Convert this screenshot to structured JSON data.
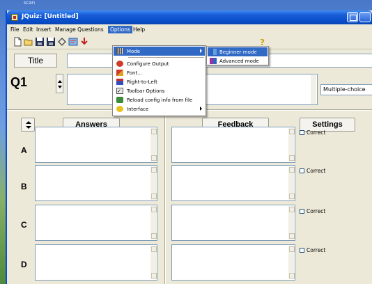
{
  "desktop": {
    "label": "scan"
  },
  "window": {
    "title": "JQuiz: [Untitled]"
  },
  "menubar": {
    "items": [
      "File",
      "Edit",
      "Insert",
      "Manage Questions",
      "Options",
      "Help"
    ],
    "active": "Options"
  },
  "toolbar": {
    "icons": [
      "new-icon",
      "open-icon",
      "save-icon",
      "save-as-icon",
      "clear-icon",
      "web-page-icon",
      "export-icon",
      "help-icon"
    ]
  },
  "title_label": "Title",
  "question": {
    "prefix": "Q",
    "number": "1",
    "type": "Multiple-choice"
  },
  "columns": {
    "answers": "Answers",
    "feedback": "Feedback",
    "settings": "Settings"
  },
  "rows": [
    {
      "letter": "A",
      "correct_label": "Correct"
    },
    {
      "letter": "B",
      "correct_label": "Correct"
    },
    {
      "letter": "C",
      "correct_label": "Correct"
    },
    {
      "letter": "D",
      "correct_label": "Correct"
    }
  ],
  "options_menu": {
    "items": [
      {
        "label": "Mode",
        "icon": "grid-icon",
        "submenu": true,
        "highlighted": true
      },
      {
        "label": "Configure Output",
        "icon": "output-icon"
      },
      {
        "label": "Font...",
        "icon": "font-icon"
      },
      {
        "label": "Right-to-Left",
        "icon": "rtl-icon"
      },
      {
        "label": "Toolbar Options",
        "icon": "toolbar-options-icon"
      },
      {
        "label": "Reload config info from file",
        "icon": "reload-icon"
      },
      {
        "label": "Interface",
        "icon": "interface-icon",
        "submenu": true
      }
    ]
  },
  "mode_submenu": {
    "items": [
      {
        "label": "Beginner mode",
        "icon": "beginner-icon",
        "highlighted": true
      },
      {
        "label": "Advanced mode",
        "icon": "advanced-icon"
      }
    ]
  },
  "colors": {
    "titlebar": "#0a4fcc",
    "highlight": "#316ac5",
    "window": "#ece9d8"
  }
}
